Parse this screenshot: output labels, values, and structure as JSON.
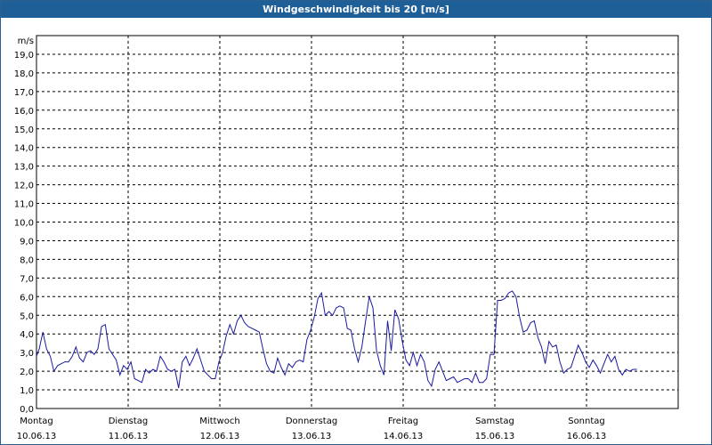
{
  "window": {
    "title": "Windgeschwindigkeit bis 20 [m/s]"
  },
  "chart_data": {
    "type": "line",
    "title": "Windgeschwindigkeit bis 20 [m/s]",
    "ylabel": "m/s",
    "ylim": [
      0,
      20
    ],
    "yticks": [
      "0,0",
      "1,0",
      "2,0",
      "3,0",
      "4,0",
      "5,0",
      "6,0",
      "7,0",
      "8,0",
      "9,0",
      "10,0",
      "11,0",
      "12,0",
      "13,0",
      "14,0",
      "15,0",
      "16,0",
      "17,0",
      "18,0",
      "19,0"
    ],
    "x_days": [
      {
        "day": "Montag",
        "date": "10.06.13"
      },
      {
        "day": "Dienstag",
        "date": "11.06.13"
      },
      {
        "day": "Mittwoch",
        "date": "12.06.13"
      },
      {
        "day": "Donnerstag",
        "date": "13.06.13"
      },
      {
        "day": "Freitag",
        "date": "14.06.13"
      },
      {
        "day": "Samstag",
        "date": "15.06.13"
      },
      {
        "day": "Sonntag",
        "date": "16.06.13"
      }
    ],
    "grid": true,
    "series": [
      {
        "color": "#1a1aa0",
        "x_days": [
          0,
          0.03,
          0.07,
          0.11,
          0.15,
          0.19,
          0.23,
          0.27,
          0.31,
          0.35,
          0.39,
          0.43,
          0.47,
          0.51,
          0.55,
          0.59,
          0.63,
          0.67,
          0.71,
          0.75,
          0.79,
          0.83,
          0.87,
          0.91,
          0.95,
          0.99,
          1.03,
          1.07,
          1.11,
          1.15,
          1.19,
          1.23,
          1.27,
          1.31,
          1.35,
          1.39,
          1.43,
          1.47,
          1.51,
          1.55,
          1.59,
          1.63,
          1.67,
          1.71,
          1.75,
          1.79,
          1.83,
          1.87,
          1.91,
          1.95,
          1.99,
          2.03,
          2.07,
          2.11,
          2.15,
          2.19,
          2.23,
          2.27,
          2.31,
          2.35,
          2.39,
          2.43,
          2.47,
          2.51,
          2.55,
          2.59,
          2.63,
          2.67,
          2.71,
          2.75,
          2.79,
          2.83,
          2.87,
          2.91,
          2.95,
          2.99,
          3.03,
          3.07,
          3.11,
          3.15,
          3.19,
          3.23,
          3.27,
          3.31,
          3.35,
          3.39,
          3.43,
          3.47,
          3.51,
          3.55,
          3.59,
          3.63,
          3.67,
          3.71,
          3.75,
          3.79,
          3.83,
          3.87,
          3.91,
          3.95,
          3.99,
          4.03,
          4.07,
          4.11,
          4.15,
          4.19,
          4.23,
          4.27,
          4.31,
          4.35,
          4.39,
          4.43,
          4.47,
          4.51,
          4.55,
          4.59,
          4.63,
          4.67,
          4.71,
          4.75,
          4.79,
          4.83,
          4.87,
          4.91,
          4.95,
          4.99,
          5.03,
          5.07,
          5.11,
          5.15,
          5.19,
          5.23,
          5.27,
          5.31,
          5.35,
          5.39,
          5.43,
          5.47,
          5.51,
          5.55,
          5.59,
          5.63,
          5.67,
          5.71,
          5.75,
          5.79,
          5.83,
          5.87,
          5.91,
          5.95,
          5.99,
          6.03,
          6.07,
          6.11,
          6.15,
          6.19,
          6.23,
          6.27,
          6.31,
          6.35,
          6.39,
          6.43,
          6.47,
          6.51,
          6.55,
          6.59,
          6.63,
          6.67,
          6.71,
          6.75,
          6.79,
          6.83,
          6.87,
          6.91,
          6.95,
          6.99
        ],
        "values": [
          2.8,
          3.2,
          4.1,
          3.2,
          2.8,
          2.0,
          2.3,
          2.4,
          2.5,
          2.5,
          2.8,
          3.3,
          2.7,
          2.5,
          3.0,
          3.1,
          2.9,
          3.2,
          4.4,
          4.5,
          3.2,
          2.9,
          2.6,
          1.8,
          2.3,
          2.1,
          2.5,
          1.6,
          1.5,
          1.4,
          2.1,
          1.9,
          2.1,
          2.0,
          2.8,
          2.5,
          2.1,
          2.0,
          2.1,
          1.1,
          2.5,
          2.8,
          2.3,
          2.7,
          3.2,
          2.6,
          2.0,
          1.8,
          1.6,
          1.6,
          2.5,
          3.0,
          3.9,
          4.5,
          4.0,
          4.7,
          5.0,
          4.6,
          4.4,
          4.3,
          4.2,
          4.1,
          3.2,
          2.4,
          2.0,
          1.9,
          2.7,
          2.2,
          1.8,
          2.4,
          2.2,
          2.5,
          2.6,
          2.5,
          3.7,
          4.2,
          4.9,
          5.9,
          6.2,
          5.0,
          5.2,
          5.0,
          5.4,
          5.5,
          5.4,
          4.3,
          4.2,
          3.2,
          2.5,
          3.3,
          4.7,
          6.0,
          5.4,
          3.1,
          2.3,
          1.8,
          4.7,
          3.1,
          5.3,
          4.8,
          3.6,
          2.6,
          2.3,
          3.0,
          2.3,
          2.9,
          2.5,
          1.5,
          1.2,
          2.1,
          2.5,
          2.0,
          1.5,
          1.6,
          1.7,
          1.4,
          1.5,
          1.6,
          1.6,
          1.4,
          1.9,
          1.4,
          1.4,
          1.6,
          2.9,
          2.9,
          5.8,
          5.8,
          5.9,
          6.2,
          6.3,
          6.0,
          4.9,
          4.1,
          4.2,
          4.6,
          4.7,
          3.8,
          3.3,
          2.4,
          3.6,
          3.3,
          3.4,
          2.5,
          1.9,
          2.1,
          2.2,
          2.8,
          3.4,
          3.0,
          2.5,
          2.2,
          2.6,
          2.3,
          1.9,
          2.4,
          2.9,
          2.5,
          2.8,
          2.1,
          1.8,
          2.1,
          2.0,
          2.1,
          2.1
        ]
      }
    ]
  }
}
